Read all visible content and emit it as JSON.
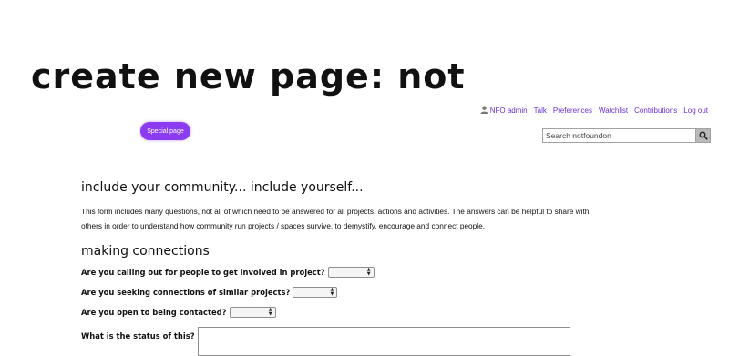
{
  "header": {
    "site_title": "create new page: not"
  },
  "user_links": {
    "username": "NFO admin",
    "items": [
      "Talk",
      "Preferences",
      "Watchlist",
      "Contributions",
      "Log out"
    ]
  },
  "special_page_label": "Special page",
  "search": {
    "placeholder": "Search notfoundon"
  },
  "content": {
    "heading1": "include your community... include yourself...",
    "intro": "This form includes many questions, not all of which need to be answered for all projects, actions and activities. The answers can be helpful to share with others in order to understand how community run projects / spaces survive, to demystify, encourage and connect people.",
    "heading2": "making connections",
    "questions": [
      {
        "label": "Are you calling out for people to get involved in project?",
        "selected": ""
      },
      {
        "label": "Are you seeking connections of similar projects?",
        "selected": ""
      },
      {
        "label": "Are you open to being contacted?",
        "selected": ""
      }
    ],
    "status_label": "What is the status of this?"
  },
  "colors": {
    "accent": "#8b3cf0",
    "link": "#6b2fd6"
  }
}
